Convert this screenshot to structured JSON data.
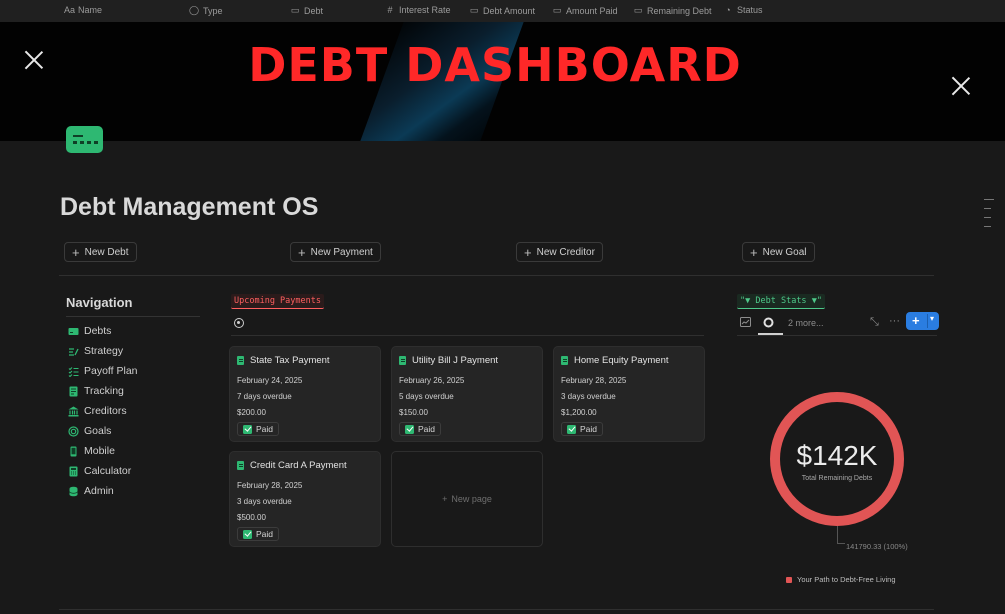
{
  "columns": [
    {
      "icon": "Aa",
      "label": "Name"
    },
    {
      "icon": "◯",
      "label": "Type"
    },
    {
      "icon": "▭",
      "label": "Debt"
    },
    {
      "icon": "#",
      "label": "Interest Rate"
    },
    {
      "icon": "▭",
      "label": "Debt Amount"
    },
    {
      "icon": "▭",
      "label": "Amount Paid"
    },
    {
      "icon": "▭",
      "label": "Remaining Debt"
    },
    {
      "icon": "◔",
      "label": "Status"
    }
  ],
  "banner": {
    "title": "DEBT DASHBOARD"
  },
  "page": {
    "title": "Debt Management OS"
  },
  "actions": {
    "new_debt": "New Debt",
    "new_payment": "New Payment",
    "new_creditor": "New Creditor",
    "new_goal": "New Goal"
  },
  "navigation": {
    "title": "Navigation",
    "items": [
      {
        "label": "Debts",
        "icon": "card-icon"
      },
      {
        "label": "Strategy",
        "icon": "strategy-icon"
      },
      {
        "label": "Payoff Plan",
        "icon": "checklist-icon"
      },
      {
        "label": "Tracking",
        "icon": "tracking-icon"
      },
      {
        "label": "Creditors",
        "icon": "bank-icon"
      },
      {
        "label": "Goals",
        "icon": "target-icon"
      },
      {
        "label": "Mobile",
        "icon": "mobile-icon"
      },
      {
        "label": "Calculator",
        "icon": "calculator-icon"
      },
      {
        "label": "Admin",
        "icon": "database-icon"
      }
    ]
  },
  "upcoming": {
    "heading": "Upcoming Payments",
    "cards": [
      {
        "title": "State Tax Payment",
        "date": "February 24, 2025",
        "overdue": "7 days overdue",
        "amount": "$200.00",
        "status": "Paid"
      },
      {
        "title": "Utility Bill J Payment",
        "date": "February 26, 2025",
        "overdue": "5 days overdue",
        "amount": "$150.00",
        "status": "Paid"
      },
      {
        "title": "Home Equity Payment",
        "date": "February 28, 2025",
        "overdue": "3 days overdue",
        "amount": "$1,200.00",
        "status": "Paid"
      },
      {
        "title": "Credit Card A Payment",
        "date": "February 28, 2025",
        "overdue": "3 days overdue",
        "amount": "$500.00",
        "status": "Paid"
      }
    ],
    "new_page": "New page"
  },
  "stats": {
    "heading": "Debt Stats",
    "more": "2 more...",
    "ring_value": "$142K",
    "ring_label": "Total Remaining Debts",
    "leader": "141790.33 (100%)",
    "legend": "Your Path to Debt-Free Living",
    "accent": "#e15555"
  },
  "chart_data": {
    "type": "pie",
    "categories": [
      "Your Path to Debt-Free Living"
    ],
    "values": [
      141790.33
    ],
    "title": "$142K",
    "subtitle": "Total Remaining Debts"
  }
}
